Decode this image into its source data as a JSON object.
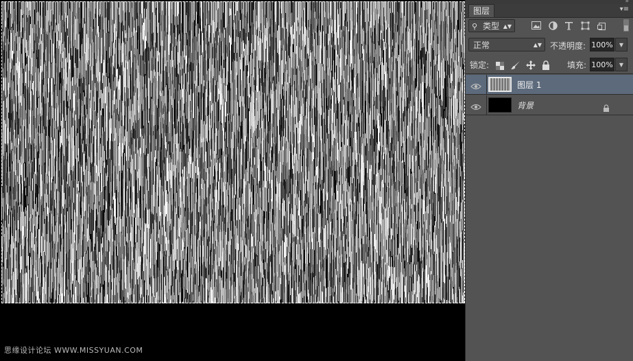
{
  "panel": {
    "tab_label": "图层",
    "filter": {
      "kind_label": "类型"
    },
    "blend_mode": "正常",
    "opacity_label": "不透明度:",
    "opacity_value": "100%",
    "lock_label": "锁定:",
    "fill_label": "填充:",
    "fill_value": "100%",
    "layers": [
      {
        "name": "图层 1",
        "selected": true,
        "visible": true
      },
      {
        "name": "背景",
        "selected": false,
        "visible": true,
        "locked": true
      }
    ]
  },
  "watermark": "思缘设计论坛 WWW.MISSYUAN.COM",
  "colors": {
    "selected_layer": "#5c6a7c",
    "panel_bg": "#535353"
  }
}
